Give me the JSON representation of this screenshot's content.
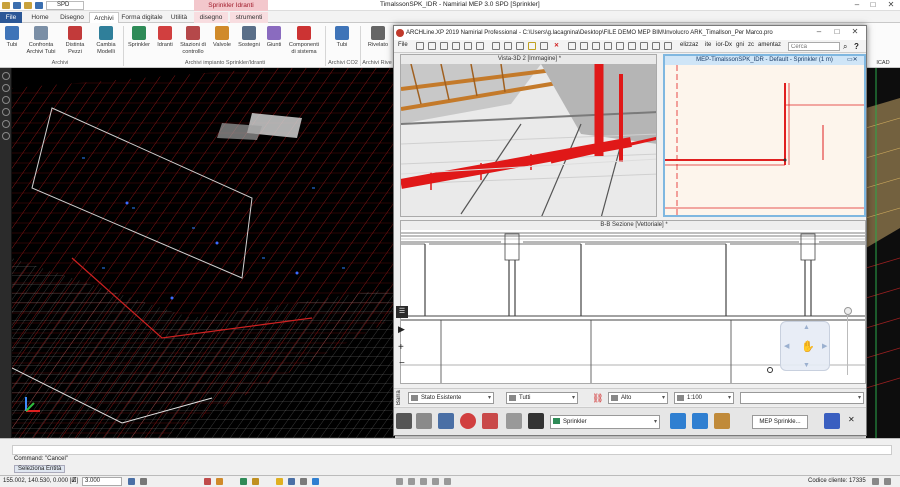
{
  "titlebar": {
    "doc_field": "SPD",
    "app_title": "TimalssonSPK_IDR - Namirial MEP 3.0 SPD [Sprinkler]",
    "context_group": "Sprinkler Idranti"
  },
  "ribbon_tabs": [
    "File",
    "Home",
    "Disegno",
    "Archivi",
    "Forma digitale",
    "Utilità",
    "disegno",
    "strumenti"
  ],
  "ribbon": {
    "buttons": [
      {
        "label": "Tubi",
        "icon": "pipe-icon",
        "color": "#3f74b8"
      },
      {
        "label": "Confronta Archivi Tubi",
        "icon": "compare-icon",
        "color": "#7b8fa6"
      },
      {
        "label": "Distinta Pezzi",
        "icon": "parts-list-icon",
        "color": "#c23a3a"
      },
      {
        "label": "Cambia Modelli",
        "icon": "swap-models-icon",
        "color": "#2f7f9a"
      },
      {
        "label": "Sprinkler",
        "icon": "sprinkler-icon",
        "color": "#2e8b57"
      },
      {
        "label": "Idranti",
        "icon": "hydrant-icon",
        "color": "#d13f3f"
      },
      {
        "label": "Stazioni di controllo",
        "icon": "control-station-icon",
        "color": "#b5484a"
      },
      {
        "label": "Valvole",
        "icon": "valve-icon",
        "color": "#d08a2a"
      },
      {
        "label": "Sostegni",
        "icon": "support-icon",
        "color": "#5a6e88"
      },
      {
        "label": "Giunti",
        "icon": "joint-icon",
        "color": "#8a6bbf"
      },
      {
        "label": "Componenti di sistema",
        "icon": "system-components-icon",
        "color": "#cc3333"
      },
      {
        "label": "Tubi",
        "icon": "pipe-icon",
        "color": "#3f74b8"
      },
      {
        "label": "Rivelato",
        "icon": "detector-icon",
        "color": "#666666"
      }
    ],
    "groups": [
      "Archivi",
      "Archivi impianto Sprinkler/Idranti",
      "Archivi CO2",
      "Archivi Rive"
    ],
    "far_right_label": "ICAD"
  },
  "floating_window": {
    "title": "ARCHLine.XP 2019  Namirial Professional - C:\\Users\\g.lacagnina\\Desktop\\FILE DEMO MEP BIM\\Involucro ARK_Timallson_Per Marco.pro",
    "menu_first": "File",
    "menu_tail": [
      "elizzaz",
      "ite",
      "ior-Dx",
      "gni",
      "zc",
      "amentaz"
    ],
    "search_placeholder": "Cerca",
    "view_3d_title": "Vista-3D 2 [Immagine] *",
    "view_plan_title": "MEP-TimalssonSPK_IDR - Default - Sprinkler (1 m)",
    "view_section_title": "B-B Sezione [Vettoriale] *",
    "bottom_bar": {
      "barra_label": "Barra",
      "stato": "Stato Esistente",
      "filtro": "Tutti",
      "livello": "Alto",
      "scala": "1:100",
      "quarto": ""
    },
    "bottom_tools": {
      "sprinkler_dropdown": "Sprinkler",
      "mep_button": "MEP Sprinkle..."
    }
  },
  "command": {
    "history": "Command: \"Cancel\"",
    "prompt": "Seleziona Entità"
  },
  "statusbar": {
    "coords": "155.002, 140.530, 0.000 [m]",
    "zoom": "3.000",
    "codice_cliente": "Codice cliente: 17335"
  },
  "colors": {
    "accent_file": "#2b5797",
    "context_tab": "#f3c7cc",
    "cad_background": "#000000",
    "pipe_red": "#e01818",
    "plan_border": "#7fb7e0"
  }
}
